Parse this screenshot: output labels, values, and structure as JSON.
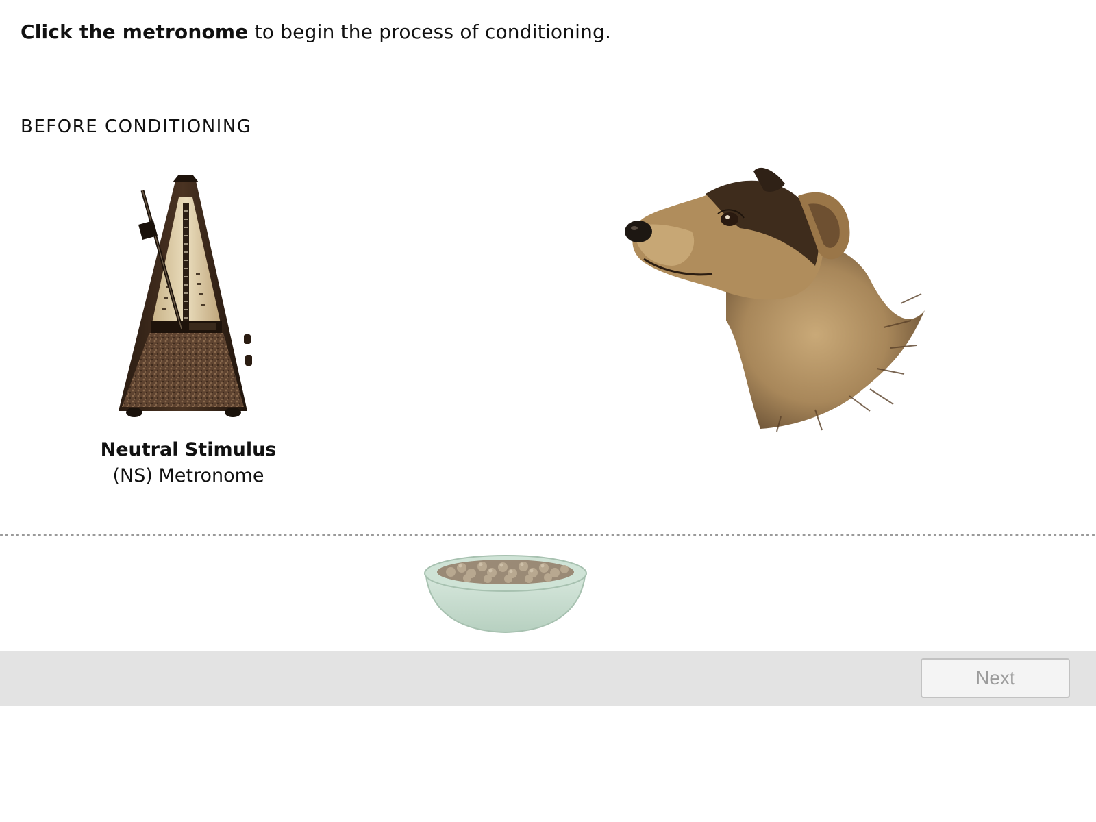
{
  "instruction": {
    "bold": "Click the metronome",
    "rest": " to begin the process of conditioning."
  },
  "section_title": "BEFORE CONDITIONING",
  "stimulus": {
    "title": "Neutral Stimulus",
    "subtitle": "(NS) Metronome"
  },
  "images": {
    "metronome": "metronome-illustration",
    "dog": "dog-head-illustration",
    "bowl": "food-bowl-illustration"
  },
  "footer": {
    "next_label": "Next",
    "next_enabled": false
  },
  "colors": {
    "footer_bg": "#e3e3e3",
    "divider": "#9a9a9a",
    "button_text_disabled": "#9c9c9c"
  }
}
